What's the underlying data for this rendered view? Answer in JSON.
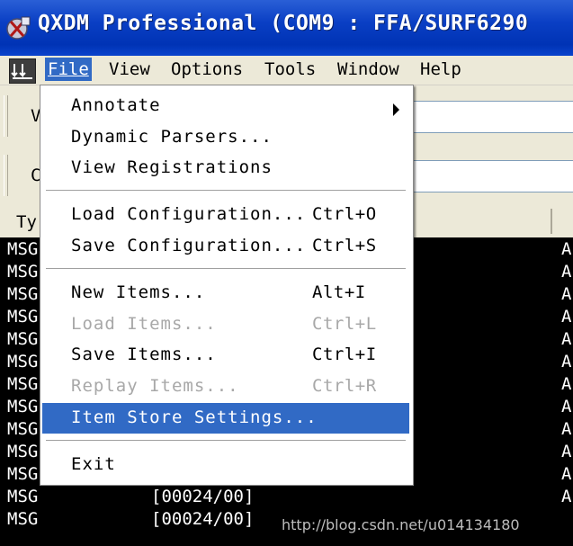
{
  "window": {
    "title": "QXDM Professional (COM9 : FFA/SURF6290"
  },
  "menubar": {
    "items": [
      {
        "label": "File",
        "active": true
      },
      {
        "label": "View"
      },
      {
        "label": "Options"
      },
      {
        "label": "Tools"
      },
      {
        "label": "Window"
      },
      {
        "label": "Help"
      }
    ]
  },
  "background": {
    "toolbar1_stub": "V",
    "toolbar2_stub": "C",
    "column_header": "Ty",
    "rows": [
      {
        "type": "MSG",
        "code": "",
        "tail": "A"
      },
      {
        "type": "MSG",
        "code": "",
        "tail": "A"
      },
      {
        "type": "MSG",
        "code": "",
        "tail": "A"
      },
      {
        "type": "MSG",
        "code": "",
        "tail": "A"
      },
      {
        "type": "MSG",
        "code": "",
        "tail": "A"
      },
      {
        "type": "MSG",
        "code": "",
        "tail": "A"
      },
      {
        "type": "MSG",
        "code": "",
        "tail": "A"
      },
      {
        "type": "MSG",
        "code": "",
        "tail": "A"
      },
      {
        "type": "MSG",
        "code": "",
        "tail": "A"
      },
      {
        "type": "MSG",
        "code": "",
        "tail": "A"
      },
      {
        "type": "MSG",
        "code": "",
        "tail": "A"
      },
      {
        "type": "MSG",
        "code": "[00024/00]",
        "tail": "A"
      },
      {
        "type": "MSG",
        "code": "[00024/00]",
        "tail": ""
      }
    ]
  },
  "file_menu": {
    "items": [
      {
        "label": "Annotate",
        "shortcut": "",
        "submenu": true
      },
      {
        "label": "Dynamic Parsers...",
        "shortcut": ""
      },
      {
        "label": "View Registrations",
        "shortcut": ""
      },
      {
        "label": "Load Configuration...",
        "shortcut": "Ctrl+O"
      },
      {
        "label": "Save Configuration...",
        "shortcut": "Ctrl+S"
      },
      {
        "label": "New Items...",
        "shortcut": "Alt+I"
      },
      {
        "label": "Load Items...",
        "shortcut": "Ctrl+L",
        "disabled": true
      },
      {
        "label": "Save Items...",
        "shortcut": "Ctrl+I"
      },
      {
        "label": "Replay Items...",
        "shortcut": "Ctrl+R",
        "disabled": true
      },
      {
        "label": "Item Store Settings...",
        "shortcut": "",
        "selected": true
      },
      {
        "label": "Exit",
        "shortcut": ""
      }
    ]
  },
  "watermark": "http://blog.csdn.net/u014134180",
  "colors": {
    "title_bar": "#0a3fc4",
    "menu_highlight": "#316ac5",
    "message_background": "#000000",
    "message_text": "#ffffff",
    "disabled_text": "#a8a8a8"
  }
}
